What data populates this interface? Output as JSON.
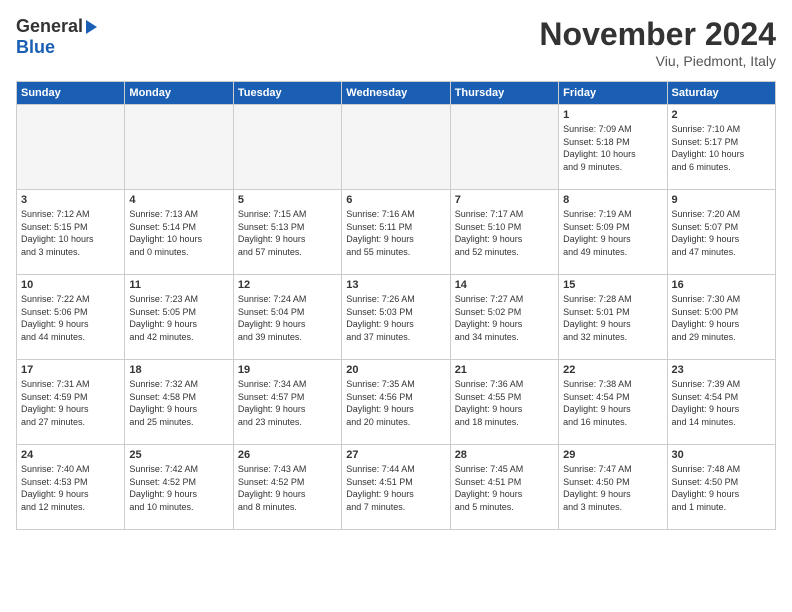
{
  "header": {
    "logo_general": "General",
    "logo_blue": "Blue",
    "month_title": "November 2024",
    "location": "Viu, Piedmont, Italy"
  },
  "days_of_week": [
    "Sunday",
    "Monday",
    "Tuesday",
    "Wednesday",
    "Thursday",
    "Friday",
    "Saturday"
  ],
  "weeks": [
    [
      {
        "day": "",
        "info": ""
      },
      {
        "day": "",
        "info": ""
      },
      {
        "day": "",
        "info": ""
      },
      {
        "day": "",
        "info": ""
      },
      {
        "day": "",
        "info": ""
      },
      {
        "day": "1",
        "info": "Sunrise: 7:09 AM\nSunset: 5:18 PM\nDaylight: 10 hours\nand 9 minutes."
      },
      {
        "day": "2",
        "info": "Sunrise: 7:10 AM\nSunset: 5:17 PM\nDaylight: 10 hours\nand 6 minutes."
      }
    ],
    [
      {
        "day": "3",
        "info": "Sunrise: 7:12 AM\nSunset: 5:15 PM\nDaylight: 10 hours\nand 3 minutes."
      },
      {
        "day": "4",
        "info": "Sunrise: 7:13 AM\nSunset: 5:14 PM\nDaylight: 10 hours\nand 0 minutes."
      },
      {
        "day": "5",
        "info": "Sunrise: 7:15 AM\nSunset: 5:13 PM\nDaylight: 9 hours\nand 57 minutes."
      },
      {
        "day": "6",
        "info": "Sunrise: 7:16 AM\nSunset: 5:11 PM\nDaylight: 9 hours\nand 55 minutes."
      },
      {
        "day": "7",
        "info": "Sunrise: 7:17 AM\nSunset: 5:10 PM\nDaylight: 9 hours\nand 52 minutes."
      },
      {
        "day": "8",
        "info": "Sunrise: 7:19 AM\nSunset: 5:09 PM\nDaylight: 9 hours\nand 49 minutes."
      },
      {
        "day": "9",
        "info": "Sunrise: 7:20 AM\nSunset: 5:07 PM\nDaylight: 9 hours\nand 47 minutes."
      }
    ],
    [
      {
        "day": "10",
        "info": "Sunrise: 7:22 AM\nSunset: 5:06 PM\nDaylight: 9 hours\nand 44 minutes."
      },
      {
        "day": "11",
        "info": "Sunrise: 7:23 AM\nSunset: 5:05 PM\nDaylight: 9 hours\nand 42 minutes."
      },
      {
        "day": "12",
        "info": "Sunrise: 7:24 AM\nSunset: 5:04 PM\nDaylight: 9 hours\nand 39 minutes."
      },
      {
        "day": "13",
        "info": "Sunrise: 7:26 AM\nSunset: 5:03 PM\nDaylight: 9 hours\nand 37 minutes."
      },
      {
        "day": "14",
        "info": "Sunrise: 7:27 AM\nSunset: 5:02 PM\nDaylight: 9 hours\nand 34 minutes."
      },
      {
        "day": "15",
        "info": "Sunrise: 7:28 AM\nSunset: 5:01 PM\nDaylight: 9 hours\nand 32 minutes."
      },
      {
        "day": "16",
        "info": "Sunrise: 7:30 AM\nSunset: 5:00 PM\nDaylight: 9 hours\nand 29 minutes."
      }
    ],
    [
      {
        "day": "17",
        "info": "Sunrise: 7:31 AM\nSunset: 4:59 PM\nDaylight: 9 hours\nand 27 minutes."
      },
      {
        "day": "18",
        "info": "Sunrise: 7:32 AM\nSunset: 4:58 PM\nDaylight: 9 hours\nand 25 minutes."
      },
      {
        "day": "19",
        "info": "Sunrise: 7:34 AM\nSunset: 4:57 PM\nDaylight: 9 hours\nand 23 minutes."
      },
      {
        "day": "20",
        "info": "Sunrise: 7:35 AM\nSunset: 4:56 PM\nDaylight: 9 hours\nand 20 minutes."
      },
      {
        "day": "21",
        "info": "Sunrise: 7:36 AM\nSunset: 4:55 PM\nDaylight: 9 hours\nand 18 minutes."
      },
      {
        "day": "22",
        "info": "Sunrise: 7:38 AM\nSunset: 4:54 PM\nDaylight: 9 hours\nand 16 minutes."
      },
      {
        "day": "23",
        "info": "Sunrise: 7:39 AM\nSunset: 4:54 PM\nDaylight: 9 hours\nand 14 minutes."
      }
    ],
    [
      {
        "day": "24",
        "info": "Sunrise: 7:40 AM\nSunset: 4:53 PM\nDaylight: 9 hours\nand 12 minutes."
      },
      {
        "day": "25",
        "info": "Sunrise: 7:42 AM\nSunset: 4:52 PM\nDaylight: 9 hours\nand 10 minutes."
      },
      {
        "day": "26",
        "info": "Sunrise: 7:43 AM\nSunset: 4:52 PM\nDaylight: 9 hours\nand 8 minutes."
      },
      {
        "day": "27",
        "info": "Sunrise: 7:44 AM\nSunset: 4:51 PM\nDaylight: 9 hours\nand 7 minutes."
      },
      {
        "day": "28",
        "info": "Sunrise: 7:45 AM\nSunset: 4:51 PM\nDaylight: 9 hours\nand 5 minutes."
      },
      {
        "day": "29",
        "info": "Sunrise: 7:47 AM\nSunset: 4:50 PM\nDaylight: 9 hours\nand 3 minutes."
      },
      {
        "day": "30",
        "info": "Sunrise: 7:48 AM\nSunset: 4:50 PM\nDaylight: 9 hours\nand 1 minute."
      }
    ]
  ]
}
